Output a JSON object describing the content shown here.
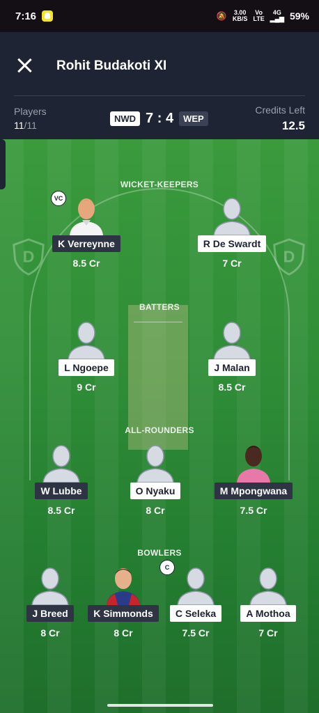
{
  "status": {
    "time": "7:16",
    "net_speed": "3.00",
    "net_unit": "KB/S",
    "volte_top": "Vo",
    "volte_bottom": "LTE",
    "network": "4G",
    "battery": "59%"
  },
  "header": {
    "title": "Rohit Budakoti XI"
  },
  "summary": {
    "players_label": "Players",
    "players_selected": "11",
    "players_total": "/11",
    "team1": "NWD",
    "team1_count": "7",
    "separator": ":",
    "team2_count": "4",
    "team2": "WEP",
    "credits_label": "Credits Left",
    "credits_value": "12.5"
  },
  "sections": {
    "wicket_keepers": "WICKET-KEEPERS",
    "batters": "BATTERS",
    "all_rounders": "ALL-ROUNDERS",
    "bowlers": "BOWLERS"
  },
  "badges": {
    "vice_captain": "VC",
    "captain": "C"
  },
  "players": {
    "wk1": {
      "name": "K Verreynne",
      "credits": "8.5 Cr",
      "team": "NWD"
    },
    "wk2": {
      "name": "R De Swardt",
      "credits": "7 Cr",
      "team": "WEP"
    },
    "bat1": {
      "name": "L Ngoepe",
      "credits": "9 Cr",
      "team": "WEP"
    },
    "bat2": {
      "name": "J Malan",
      "credits": "8.5 Cr",
      "team": "WEP"
    },
    "ar1": {
      "name": "W Lubbe",
      "credits": "8.5 Cr",
      "team": "NWD"
    },
    "ar2": {
      "name": "O Nyaku",
      "credits": "8 Cr",
      "team": "WEP"
    },
    "ar3": {
      "name": "M Mpongwana",
      "credits": "7.5 Cr",
      "team": "NWD"
    },
    "bowl1": {
      "name": "J Breed",
      "credits": "8 Cr",
      "team": "NWD"
    },
    "bowl2": {
      "name": "K Simmonds",
      "credits": "8 Cr",
      "team": "NWD"
    },
    "bowl3": {
      "name": "C Seleka",
      "credits": "7.5 Cr",
      "team": "WEP"
    },
    "bowl4": {
      "name": "A Mothoa",
      "credits": "7 Cr",
      "team": "WEP"
    }
  },
  "colors": {
    "header_bg": "#1e2433",
    "field_green": "#2f8d37",
    "team1_tag": "#2e3444",
    "team2_tag": "#ffffff"
  }
}
